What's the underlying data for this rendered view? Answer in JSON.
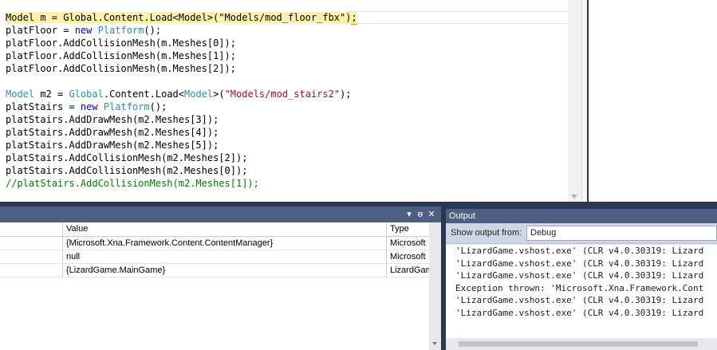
{
  "editor": {
    "lines": [
      [
        {
          "t": "Model m = Global.Content.Load<Model>(\"Models/mod_floor_fbx\")",
          "c": "hl"
        },
        {
          "t": ";",
          "c": "hl squiggle"
        }
      ],
      [
        {
          "t": "platFloor = ",
          "c": ""
        },
        {
          "t": "new",
          "c": "t-kw"
        },
        {
          "t": " ",
          "c": ""
        },
        {
          "t": "Platform",
          "c": "t-type"
        },
        {
          "t": "();",
          "c": ""
        }
      ],
      [
        {
          "t": "platFloor.AddCollisionMesh(m.Meshes[0]);",
          "c": ""
        }
      ],
      [
        {
          "t": "platFloor.AddCollisionMesh(m.Meshes[1]);",
          "c": ""
        }
      ],
      [
        {
          "t": "platFloor.AddCollisionMesh(m.Meshes[2]);",
          "c": ""
        }
      ],
      [
        {
          "t": "",
          "c": ""
        }
      ],
      [
        {
          "t": "Model",
          "c": "t-type"
        },
        {
          "t": " m2 = ",
          "c": ""
        },
        {
          "t": "Global",
          "c": "t-type"
        },
        {
          "t": ".Content.Load<",
          "c": ""
        },
        {
          "t": "Model",
          "c": "t-type"
        },
        {
          "t": ">(",
          "c": ""
        },
        {
          "t": "\"Models/mod_stairs2\"",
          "c": "t-str"
        },
        {
          "t": ");",
          "c": ""
        }
      ],
      [
        {
          "t": "platStairs = ",
          "c": ""
        },
        {
          "t": "new",
          "c": "t-kw"
        },
        {
          "t": " ",
          "c": ""
        },
        {
          "t": "Platform",
          "c": "t-type"
        },
        {
          "t": "();",
          "c": ""
        }
      ],
      [
        {
          "t": "platStairs.AddDrawMesh(m2.Meshes[3]);",
          "c": ""
        }
      ],
      [
        {
          "t": "platStairs.AddDrawMesh(m2.Meshes[4]);",
          "c": ""
        }
      ],
      [
        {
          "t": "platStairs.AddDrawMesh(m2.Meshes[5]);",
          "c": ""
        }
      ],
      [
        {
          "t": "platStairs.AddCollisionMesh(m2.Meshes[2]);",
          "c": ""
        }
      ],
      [
        {
          "t": "platStairs.AddCollisionMesh(m2.Meshes[0]);",
          "c": ""
        }
      ],
      [
        {
          "t": "//platStairs.AddCollisionMesh(m2.Meshes[1]);",
          "c": "t-cm"
        }
      ]
    ]
  },
  "locals": {
    "title_buttons": [
      "▾",
      "ᵿ",
      "✕"
    ],
    "columns": {
      "name": "",
      "value": "Value",
      "type": "Type"
    },
    "rows": [
      {
        "name": "",
        "value": "{Microsoft.Xna.Framework.Content.ContentManager}",
        "type": "Microsoft"
      },
      {
        "name": "",
        "value": "null",
        "type": "Microsoft"
      },
      {
        "name": "",
        "value": "{LizardGame.MainGame}",
        "type": "LizardGame"
      }
    ]
  },
  "output": {
    "title": "Output",
    "show_label": "Show output from:",
    "source": "Debug",
    "lines": [
      "'LizardGame.vshost.exe' (CLR v4.0.30319: Lizard",
      "'LizardGame.vshost.exe' (CLR v4.0.30319: Lizard",
      "'LizardGame.vshost.exe' (CLR v4.0.30319: Lizard",
      "Exception thrown: 'Microsoft.Xna.Framework.Cont",
      "'LizardGame.vshost.exe' (CLR v4.0.30319: Lizard",
      "'LizardGame.vshost.exe' (CLR v4.0.30319: Lizard"
    ]
  }
}
